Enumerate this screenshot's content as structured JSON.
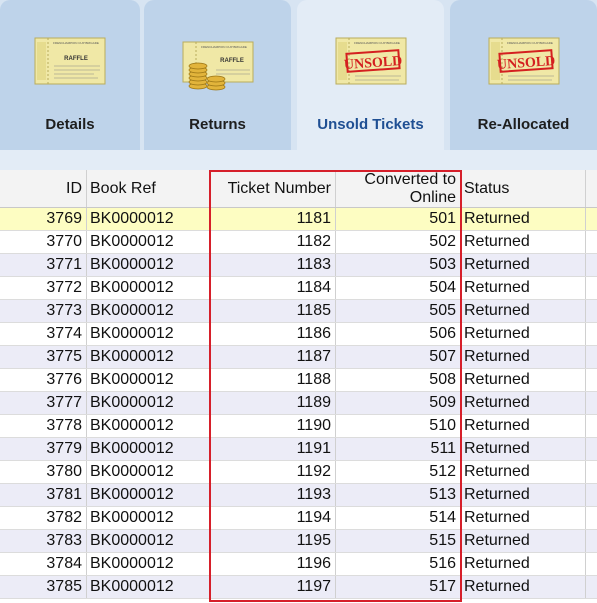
{
  "tabs": [
    {
      "id": "details",
      "label": "Details",
      "icon": "raffle-ticket-icon",
      "stamp": ""
    },
    {
      "id": "returns",
      "label": "Returns",
      "icon": "ticket-coins-icon",
      "stamp": ""
    },
    {
      "id": "unsold",
      "label": "Unsold Tickets",
      "icon": "unsold-ticket-icon",
      "stamp": "UNSOLD",
      "active": true
    },
    {
      "id": "reallocated",
      "label": "Re-Allocated",
      "icon": "unsold-ticket-icon",
      "stamp": "UNSOLD"
    }
  ],
  "ticket_art": {
    "top_line": "FRENCHAMPION CUP BRIGADE",
    "mid_line": "RAFFLE"
  },
  "colors": {
    "accent_red": "#d61f2a",
    "active_tab_text": "#1f4f93",
    "selected_row": "#fdfdc2",
    "alt_row": "#ececf7"
  },
  "grid": {
    "columns": {
      "id": "ID",
      "book_ref": "Book Ref",
      "ticket_number": "Ticket Number",
      "converted": "Converted to Online",
      "status": "Status"
    },
    "rows": [
      {
        "id": "3769",
        "book_ref": "BK0000012",
        "ticket_number": "1181",
        "converted": "501",
        "status": "Returned",
        "selected": true
      },
      {
        "id": "3770",
        "book_ref": "BK0000012",
        "ticket_number": "1182",
        "converted": "502",
        "status": "Returned"
      },
      {
        "id": "3771",
        "book_ref": "BK0000012",
        "ticket_number": "1183",
        "converted": "503",
        "status": "Returned"
      },
      {
        "id": "3772",
        "book_ref": "BK0000012",
        "ticket_number": "1184",
        "converted": "504",
        "status": "Returned"
      },
      {
        "id": "3773",
        "book_ref": "BK0000012",
        "ticket_number": "1185",
        "converted": "505",
        "status": "Returned"
      },
      {
        "id": "3774",
        "book_ref": "BK0000012",
        "ticket_number": "1186",
        "converted": "506",
        "status": "Returned"
      },
      {
        "id": "3775",
        "book_ref": "BK0000012",
        "ticket_number": "1187",
        "converted": "507",
        "status": "Returned"
      },
      {
        "id": "3776",
        "book_ref": "BK0000012",
        "ticket_number": "1188",
        "converted": "508",
        "status": "Returned"
      },
      {
        "id": "3777",
        "book_ref": "BK0000012",
        "ticket_number": "1189",
        "converted": "509",
        "status": "Returned"
      },
      {
        "id": "3778",
        "book_ref": "BK0000012",
        "ticket_number": "1190",
        "converted": "510",
        "status": "Returned"
      },
      {
        "id": "3779",
        "book_ref": "BK0000012",
        "ticket_number": "1191",
        "converted": "511",
        "status": "Returned"
      },
      {
        "id": "3780",
        "book_ref": "BK0000012",
        "ticket_number": "1192",
        "converted": "512",
        "status": "Returned"
      },
      {
        "id": "3781",
        "book_ref": "BK0000012",
        "ticket_number": "1193",
        "converted": "513",
        "status": "Returned"
      },
      {
        "id": "3782",
        "book_ref": "BK0000012",
        "ticket_number": "1194",
        "converted": "514",
        "status": "Returned"
      },
      {
        "id": "3783",
        "book_ref": "BK0000012",
        "ticket_number": "1195",
        "converted": "515",
        "status": "Returned"
      },
      {
        "id": "3784",
        "book_ref": "BK0000012",
        "ticket_number": "1196",
        "converted": "516",
        "status": "Returned"
      },
      {
        "id": "3785",
        "book_ref": "BK0000012",
        "ticket_number": "1197",
        "converted": "517",
        "status": "Returned"
      }
    ]
  }
}
